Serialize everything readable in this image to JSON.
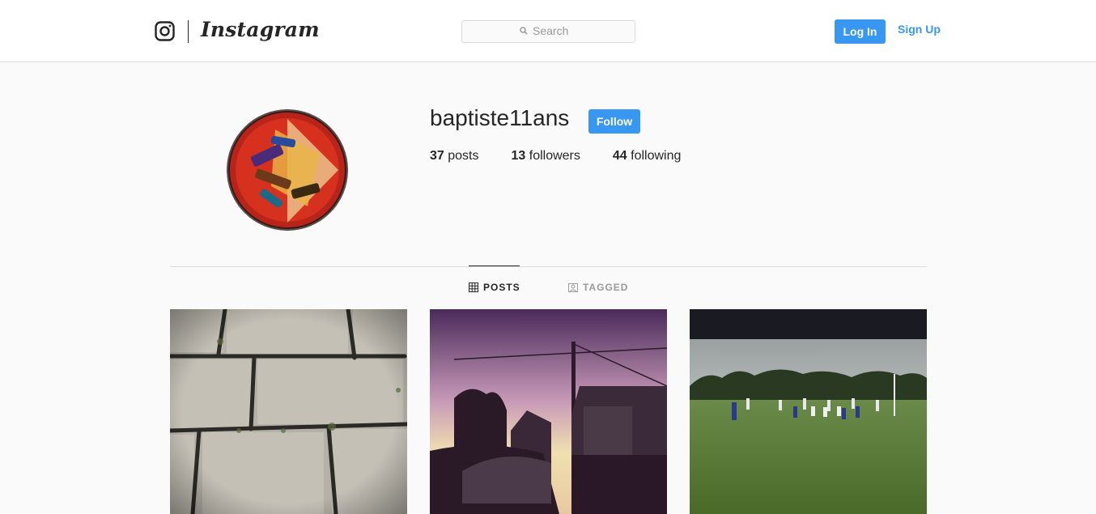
{
  "header": {
    "brand": "Instagram",
    "search_placeholder": "Search",
    "login_label": "Log In",
    "signup_label": "Sign Up"
  },
  "profile": {
    "username": "baptiste11ans",
    "follow_label": "Follow",
    "stats": [
      {
        "count": "37",
        "label": "posts"
      },
      {
        "count": "13",
        "label": "followers"
      },
      {
        "count": "44",
        "label": "following"
      }
    ]
  },
  "tabs": [
    {
      "label": "POSTS",
      "active": true,
      "icon": "grid-icon"
    },
    {
      "label": "TAGGED",
      "active": false,
      "icon": "tagged-icon"
    }
  ],
  "posts": [
    {
      "subject": "paving stones with grass"
    },
    {
      "subject": "sunset over houses"
    },
    {
      "subject": "football field with players"
    }
  ],
  "colors": {
    "accent": "#3897f0",
    "text": "#262626",
    "muted": "#999999",
    "border": "#dbdbdb",
    "background": "#fafafa"
  }
}
